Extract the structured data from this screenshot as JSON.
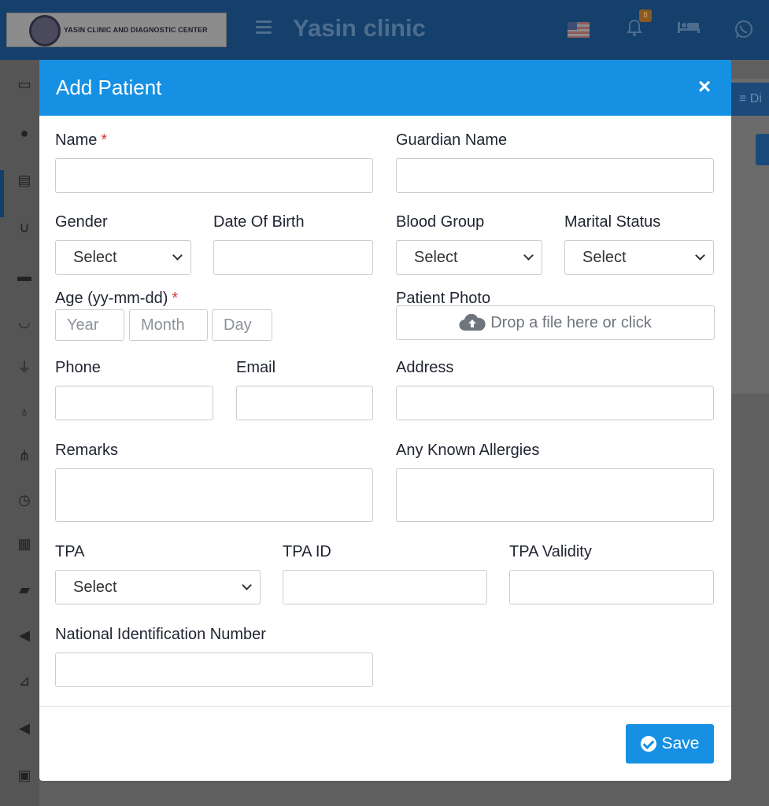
{
  "app": {
    "logo_text": "YASIN CLINIC AND DIAGNOSTIC CENTER",
    "title": "Yasin clinic",
    "notification_count": "8",
    "right_tab_label": "≡ Di"
  },
  "icons": {
    "menu": "hamburger-menu-icon",
    "flag": "us-flag-icon",
    "bell": "bell-icon",
    "bed": "bed-icon",
    "whatsapp": "whatsapp-icon",
    "close": "close-icon",
    "upload": "cloud-upload-icon",
    "save": "check-circle-icon"
  },
  "colors": {
    "header_blue": "#1590e3",
    "topbar": "#14406b",
    "required": "#d13a3a"
  },
  "modal": {
    "title": "Add Patient",
    "close_symbol": "×"
  },
  "form": {
    "name_label": "Name",
    "required_mark": "*",
    "guardian_label": "Guardian Name",
    "gender_label": "Gender",
    "gender_value": "Select",
    "dob_label": "Date Of Birth",
    "blood_group_label": "Blood Group",
    "blood_group_value": "Select",
    "marital_label": "Marital Status",
    "marital_value": "Select",
    "age_label": "Age (yy-mm-dd)",
    "age_year_placeholder": "Year",
    "age_month_placeholder": "Month",
    "age_day_placeholder": "Day",
    "photo_label": "Patient Photo",
    "photo_dropzone": "Drop a file here or click",
    "phone_label": "Phone",
    "email_label": "Email",
    "address_label": "Address",
    "remarks_label": "Remarks",
    "allergies_label": "Any Known Allergies",
    "tpa_label": "TPA",
    "tpa_value": "Select",
    "tpa_id_label": "TPA ID",
    "tpa_validity_label": "TPA Validity",
    "nid_label": "National Identification Number"
  },
  "footer": {
    "save_label": "Save"
  }
}
